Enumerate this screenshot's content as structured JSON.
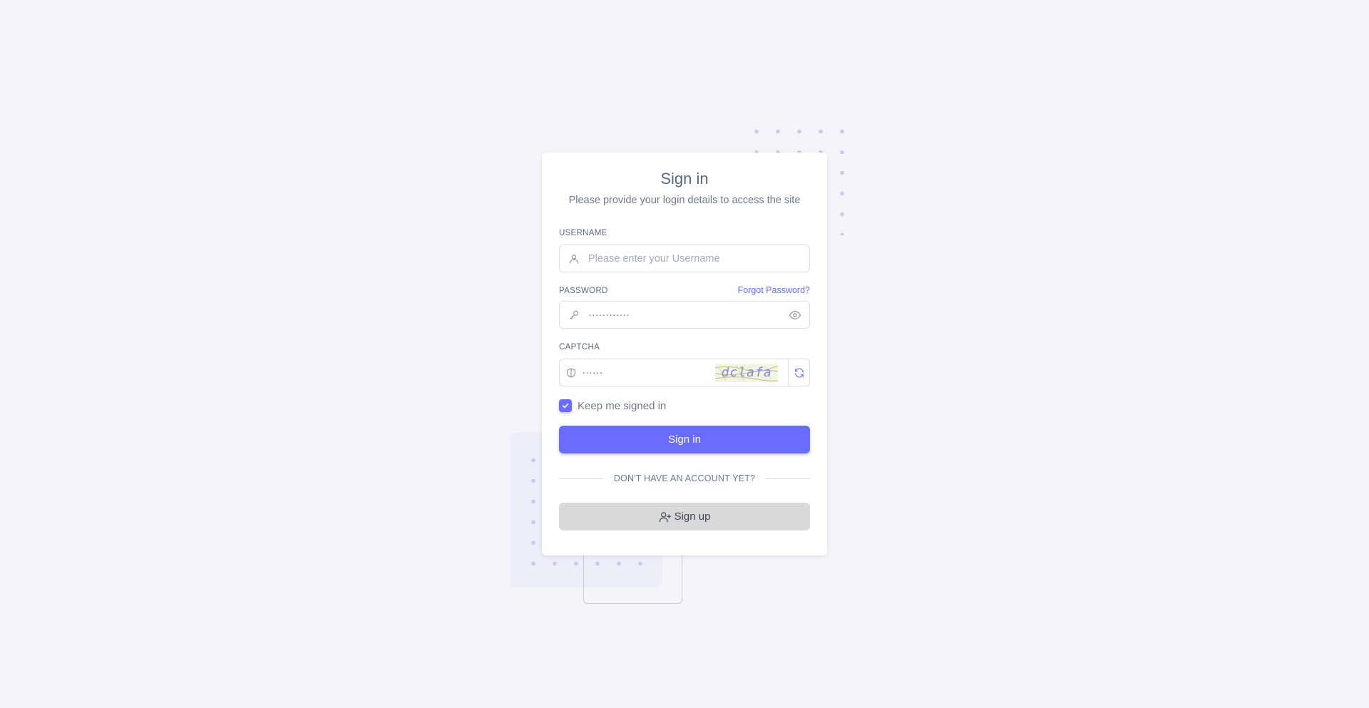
{
  "heading": {
    "title": "Sign in",
    "subtitle": "Please provide your login details to access the site"
  },
  "username": {
    "label": "USERNAME",
    "placeholder": "Please enter your Username",
    "value": ""
  },
  "password": {
    "label": "PASSWORD",
    "forgot_link": "Forgot Password?",
    "value": "············"
  },
  "captcha": {
    "label": "CAPTCHA",
    "value": "······",
    "image_text": "dclafa"
  },
  "remember": {
    "label": "Keep me signed in",
    "checked": true
  },
  "signin_button": "Sign in",
  "divider_text": "DON'T HAVE AN ACCOUNT YET?",
  "signup_button": "Sign up",
  "colors": {
    "primary": "#696cff",
    "background": "#f5f5f9",
    "secondary_button": "#d9d9d9"
  }
}
